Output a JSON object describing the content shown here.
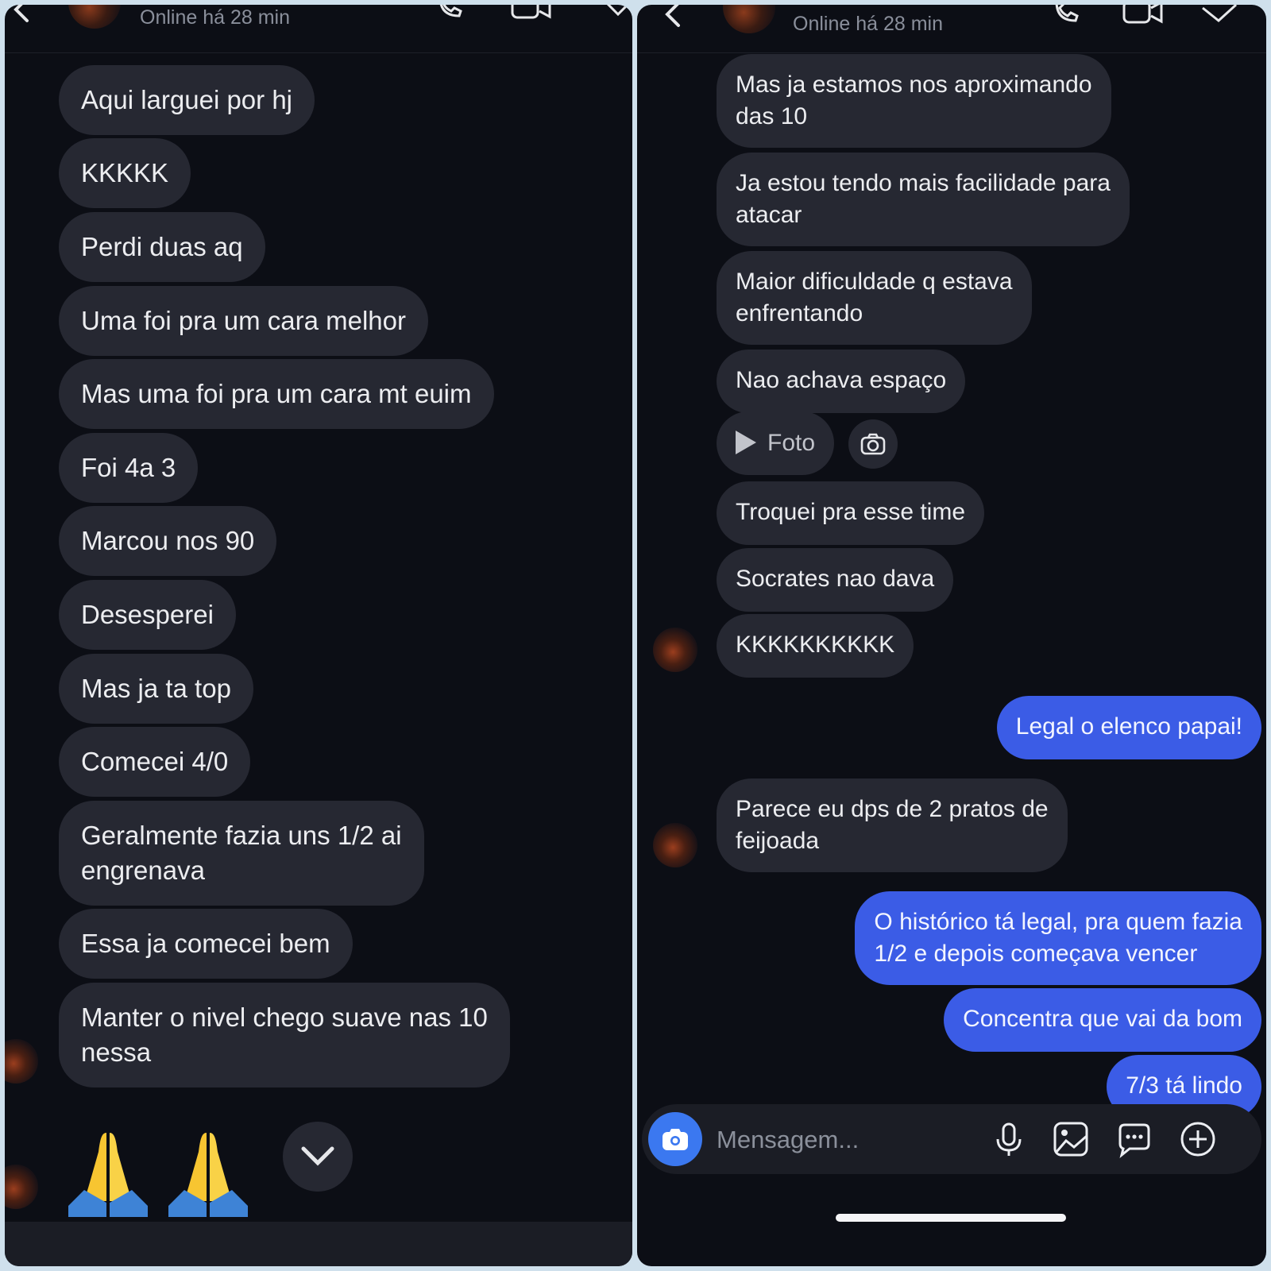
{
  "header": {
    "status": "Online há 28 min"
  },
  "left_messages": [
    "Aqui larguei por hj",
    "KKKKK",
    "Perdi duas aq",
    "Uma foi pra um cara melhor",
    "Mas uma foi pra um cara mt euim",
    "Foi 4a 3",
    "Marcou nos 90",
    "Desesperei",
    "Mas ja ta top",
    "Comecei 4/0",
    "Geralmente fazia uns 1/2 ai\nengrenava",
    "Essa ja comecei bem",
    "Manter o nivel chego suave nas 10\nnessa"
  ],
  "right_messages": [
    "Mas ja estamos nos aproximando\ndas 10",
    "Ja estou tendo mais facilidade para\natacar",
    "Maior dificuldade q estava\nenfrentando",
    "Nao achava espaço",
    "Troquei pra esse time",
    "Socrates nao dava",
    "KKKKKKKKKK",
    "Legal o elenco papai!",
    "Parece eu dps de 2 pratos de\nfeijoada",
    "O histórico tá legal, pra quem fazia\n1/2 e depois começava vencer",
    "Concentra que vai da bom",
    "7/3 tá lindo"
  ],
  "foto_label": "Foto",
  "composer": {
    "placeholder": "Mensagem..."
  },
  "reaction_emoji": "🙏🙏",
  "colors": {
    "received": "#262832",
    "sent": "#3b5ce6",
    "background": "#0c0e15"
  }
}
